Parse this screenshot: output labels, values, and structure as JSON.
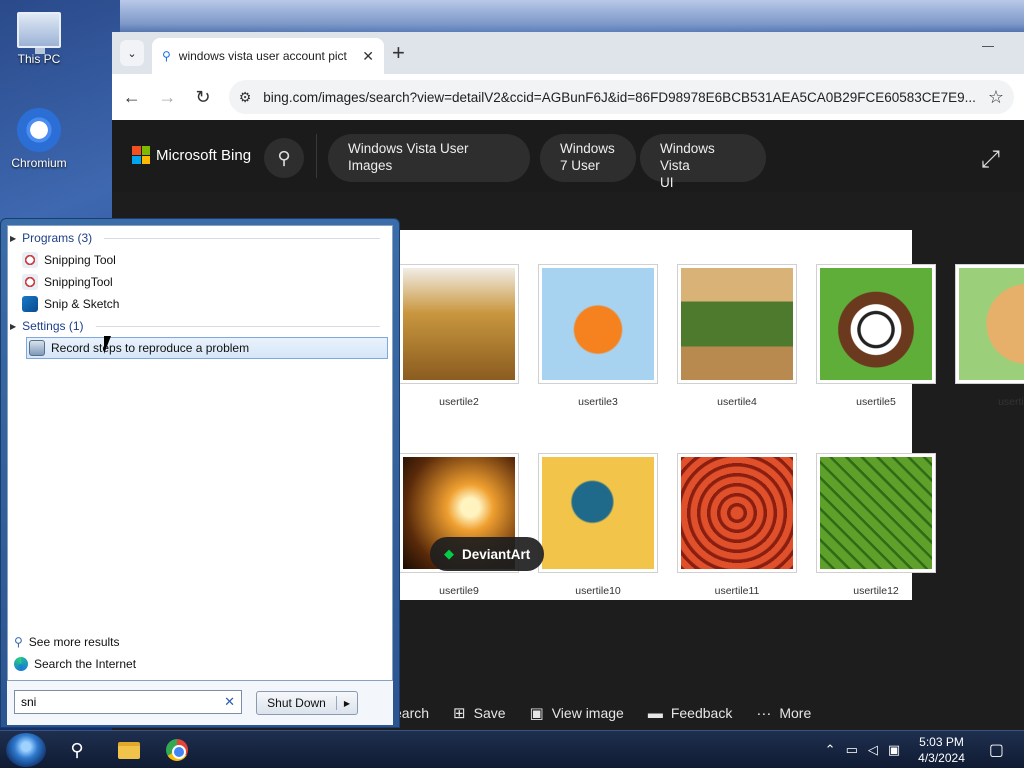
{
  "desktop": {
    "icons": [
      {
        "label": "This PC"
      },
      {
        "label": "Chromium"
      }
    ]
  },
  "browser": {
    "tab_title": "windows vista user account pict",
    "url": "bing.com/images/search?view=detailV2&ccid=AGBunF6J&id=86FD98978E6BCB531AEA5CA0B29FCE60583CE7E9..."
  },
  "bing": {
    "logo_text": "Microsoft Bing",
    "chips": [
      "Windows Vista User Images",
      "Windows\n7 User",
      "Windows Vista\nUI"
    ]
  },
  "tiles": [
    {
      "label": "usertile2",
      "color": "#b88a3a"
    },
    {
      "label": "usertile3",
      "color": "#f29a1e"
    },
    {
      "label": "usertile4",
      "color": "#6e8a3e"
    },
    {
      "label": "usertile5",
      "color": "#4e8a38"
    },
    {
      "label": "usertile",
      "color": "#d8a050"
    },
    {
      "label": "usertile9",
      "color": "#c07020"
    },
    {
      "label": "usertile10",
      "color": "#e8b23a"
    },
    {
      "label": "usertile11",
      "color": "#d04a2a"
    },
    {
      "label": "usertile12",
      "color": "#3e7a20"
    }
  ],
  "deviantart_badge": "DeviantArt",
  "actions": [
    {
      "label": "earch",
      "icon": "search-icon"
    },
    {
      "label": "Save",
      "icon": "save-icon"
    },
    {
      "label": "View image",
      "icon": "image-icon"
    },
    {
      "label": "Feedback",
      "icon": "feedback-icon"
    },
    {
      "label": "More",
      "icon": "more-icon"
    }
  ],
  "start_menu": {
    "programs_header": "Programs (3)",
    "programs": [
      "Snipping Tool",
      "SnippingTool",
      "Snip & Sketch"
    ],
    "settings_header": "Settings (1)",
    "settings": [
      "Record steps to reproduce a problem"
    ],
    "see_more": "See more results",
    "search_internet": "Search the Internet",
    "search_value": "sni",
    "shutdown_label": "Shut Down"
  },
  "taskbar": {
    "time": "5:03 PM",
    "date": "4/3/2024"
  }
}
